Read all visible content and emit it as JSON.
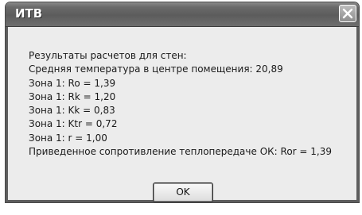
{
  "window": {
    "title": "ИТВ"
  },
  "message": {
    "lines": [
      "Результаты расчетов для стен:",
      "Средняя температура в центре помещения: 20,89",
      "Зона 1: Ro = 1,39",
      "Зона 1: Rk = 1,20",
      "Зона 1: Kk = 0,83",
      "Зона 1: Ktr = 0,72",
      "Зона 1: r = 1,00",
      "Приведенное сопротивление теплопередаче ОК: Ror = 1,39"
    ]
  },
  "buttons": {
    "ok_label": "OK"
  },
  "icons": {
    "close": "close-icon"
  },
  "colors": {
    "titlebar": "#5c5c5c",
    "client_background": "#ececec"
  }
}
